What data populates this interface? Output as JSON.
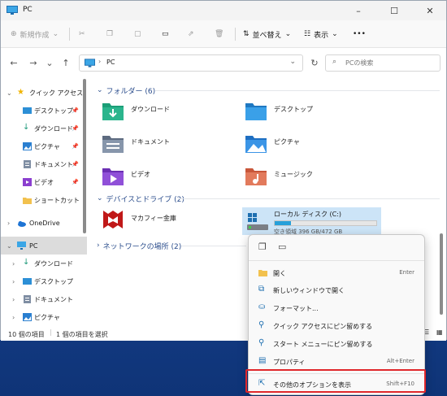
{
  "window": {
    "title": "PC"
  },
  "toolbar": {
    "new_label": "新規作成",
    "sort_label": "並べ替え",
    "view_label": "表示",
    "more_label": "•••"
  },
  "address": {
    "path": "PC",
    "search_placeholder": "PCの検索"
  },
  "sidebar": {
    "items": [
      {
        "label": "クイック アクセス"
      },
      {
        "label": "デスクトップ"
      },
      {
        "label": "ダウンロード"
      },
      {
        "label": "ピクチャ"
      },
      {
        "label": "ドキュメント"
      },
      {
        "label": "ビデオ"
      },
      {
        "label": "ショートカット"
      },
      {
        "label": "OneDrive"
      },
      {
        "label": "PC"
      },
      {
        "label": "ダウンロード"
      },
      {
        "label": "デスクトップ"
      },
      {
        "label": "ドキュメント"
      },
      {
        "label": "ピクチャ"
      }
    ]
  },
  "main": {
    "folders_header": "フォルダー (6)",
    "folders": [
      {
        "label": "ダウンロード"
      },
      {
        "label": "デスクトップ"
      },
      {
        "label": "ドキュメント"
      },
      {
        "label": "ピクチャ"
      },
      {
        "label": "ビデオ"
      },
      {
        "label": "ミュージック"
      }
    ],
    "devices_header": "デバイスとドライブ (2)",
    "mcafee_label": "マカフィー金庫",
    "drive_label": "ローカル ディスク (C:)",
    "drive_space": "空き領域 396 GB/472 GB",
    "drive_used_fraction": 0.16,
    "network_header": "ネットワークの場所 (2)"
  },
  "status": {
    "item_count": "10 個の項目",
    "selected": "1 個の項目を選択"
  },
  "context_menu": {
    "items": [
      {
        "label": "開く",
        "shortcut": "Enter"
      },
      {
        "label": "新しいウィンドウで開く",
        "shortcut": ""
      },
      {
        "label": "フォーマット...",
        "shortcut": ""
      },
      {
        "label": "クイック アクセスにピン留めする",
        "shortcut": ""
      },
      {
        "label": "スタート メニューにピン留めする",
        "shortcut": ""
      },
      {
        "label": "プロパティ",
        "shortcut": "Alt+Enter"
      },
      {
        "label": "その他のオプションを表示",
        "shortcut": "Shift+F10"
      }
    ]
  },
  "colors": {
    "accent": "#26a0da",
    "highlight_border": "#e0282b",
    "group_header": "#2b4d8c"
  }
}
